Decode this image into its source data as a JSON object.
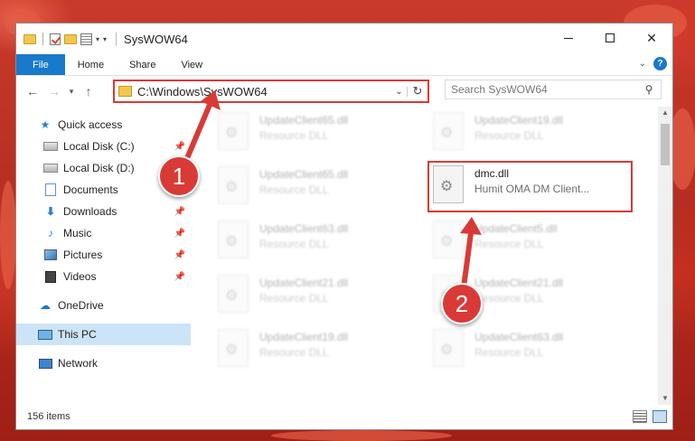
{
  "window": {
    "title": "SysWOW64"
  },
  "ribbon": {
    "tabs": [
      "File",
      "Home",
      "Share",
      "View"
    ],
    "help_label": "?"
  },
  "nav": {
    "address": "C:\\Windows\\SysWOW64",
    "search_placeholder": "Search SysWOW64"
  },
  "sidebar": {
    "items": [
      {
        "label": "Quick access",
        "icon": "star-icon"
      },
      {
        "label": "Local Disk (C:)",
        "icon": "drive-icon"
      },
      {
        "label": "Local Disk (D:)",
        "icon": "drive-icon"
      },
      {
        "label": "Documents",
        "icon": "document-icon"
      },
      {
        "label": "Downloads",
        "icon": "download-icon"
      },
      {
        "label": "Music",
        "icon": "music-icon"
      },
      {
        "label": "Pictures",
        "icon": "pictures-icon"
      },
      {
        "label": "Videos",
        "icon": "videos-icon"
      },
      {
        "label": "OneDrive",
        "icon": "cloud-icon"
      },
      {
        "label": "This PC",
        "icon": "computer-icon"
      },
      {
        "label": "Network",
        "icon": "network-icon"
      }
    ]
  },
  "files": {
    "left": [
      {
        "name": "UpdateClient65.dll",
        "type": "Resource DLL"
      },
      {
        "name": "UpdateClient65.dll",
        "type": "Resource DLL"
      },
      {
        "name": "UpdateClient63.dll",
        "type": "Resource DLL"
      },
      {
        "name": "UpdateClient21.dll",
        "type": "Resource DLL"
      },
      {
        "name": "UpdateClient19.dll",
        "type": "Resource DLL"
      }
    ],
    "right": [
      {
        "name": "UpdateClient19.dll",
        "type": "Resource DLL"
      },
      {
        "name": "dmc.dll",
        "type": "Humit OMA DM Client..."
      },
      {
        "name": "UpdateClient5.dll",
        "type": "Resource DLL"
      },
      {
        "name": "UpdateClient21.dll",
        "type": "Resource DLL"
      },
      {
        "name": "UpdateClient63.dll",
        "type": "Resource DLL"
      }
    ]
  },
  "status": {
    "count": "156 items"
  },
  "callouts": [
    "1",
    "2"
  ],
  "colors": {
    "accent": "#1979ca",
    "highlight": "#d93a36"
  }
}
